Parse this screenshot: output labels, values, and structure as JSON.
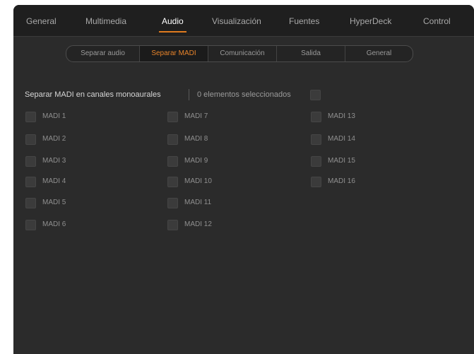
{
  "top_tabs": [
    {
      "label": "General",
      "active": false
    },
    {
      "label": "Multimedia",
      "active": false
    },
    {
      "label": "Audio",
      "active": true
    },
    {
      "label": "Visualización",
      "active": false
    },
    {
      "label": "Fuentes",
      "active": false
    },
    {
      "label": "HyperDeck",
      "active": false
    },
    {
      "label": "Control",
      "active": false
    }
  ],
  "sub_tabs": [
    {
      "label": "Separar audio",
      "active": false
    },
    {
      "label": "Separar MADI",
      "active": true
    },
    {
      "label": "Comunicación",
      "active": false
    },
    {
      "label": "Salida",
      "active": false
    },
    {
      "label": "General",
      "active": false
    }
  ],
  "section": {
    "title": "Separar MADI en canales monoaurales",
    "selected_count": "0 elementos seleccionados",
    "select_all_checked": false
  },
  "channels": {
    "col1": [
      {
        "label": "MADI 1",
        "checked": false
      },
      {
        "label": "MADI 2",
        "checked": false
      },
      {
        "label": "MADI 3",
        "checked": false
      },
      {
        "label": "MADI 4",
        "checked": false
      },
      {
        "label": "MADI 5",
        "checked": false
      },
      {
        "label": "MADI 6",
        "checked": false
      }
    ],
    "col2": [
      {
        "label": "MADI 7",
        "checked": false
      },
      {
        "label": "MADI 8",
        "checked": false
      },
      {
        "label": "MADI 9",
        "checked": false
      },
      {
        "label": "MADI 10",
        "checked": false
      },
      {
        "label": "MADI 11",
        "checked": false
      },
      {
        "label": "MADI 12",
        "checked": false
      }
    ],
    "col3": [
      {
        "label": "MADI 13",
        "checked": false
      },
      {
        "label": "MADI 14",
        "checked": false
      },
      {
        "label": "MADI 15",
        "checked": false
      },
      {
        "label": "MADI 16",
        "checked": false
      }
    ]
  },
  "colors": {
    "accent": "#e07b1f",
    "background": "#2b2b2b",
    "tabbar": "#1f1f1f"
  }
}
